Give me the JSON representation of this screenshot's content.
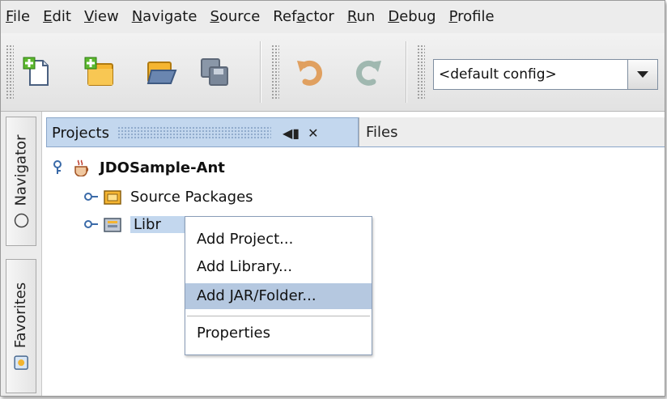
{
  "menubar": {
    "items": [
      {
        "pre": "",
        "u": "F",
        "post": "ile"
      },
      {
        "pre": "",
        "u": "E",
        "post": "dit"
      },
      {
        "pre": "",
        "u": "V",
        "post": "iew"
      },
      {
        "pre": "",
        "u": "N",
        "post": "avigate"
      },
      {
        "pre": "",
        "u": "S",
        "post": "ource"
      },
      {
        "pre": "Ref",
        "u": "a",
        "post": "ctor"
      },
      {
        "pre": "",
        "u": "R",
        "post": "un"
      },
      {
        "pre": "",
        "u": "D",
        "post": "ebug"
      },
      {
        "pre": "",
        "u": "P",
        "post": "rofile"
      }
    ]
  },
  "toolbar": {
    "buttons": [
      "new-file-icon",
      "new-project-icon",
      "open-project-icon",
      "save-all-icon",
      "undo-icon",
      "redo-icon"
    ],
    "config_value": "<default config>"
  },
  "side": {
    "navigator_label": "Navigator",
    "favorites_label": "Favorites"
  },
  "tabs": {
    "projects_label": "Projects",
    "minimize_glyph": "◀▮",
    "close_glyph": "✕",
    "files_label": "Files"
  },
  "tree": {
    "project_name": "JDOSample-Ant",
    "source_packages": "Source Packages",
    "libraries_partial": "Libr"
  },
  "context_menu": {
    "items": [
      "Add Project...",
      "Add Library...",
      "Add JAR/Folder...",
      "Properties"
    ],
    "highlighted": "Add JAR/Folder..."
  },
  "colors": {
    "selection": "#c3d7ee",
    "menu_hover": "#b5c8e0"
  }
}
